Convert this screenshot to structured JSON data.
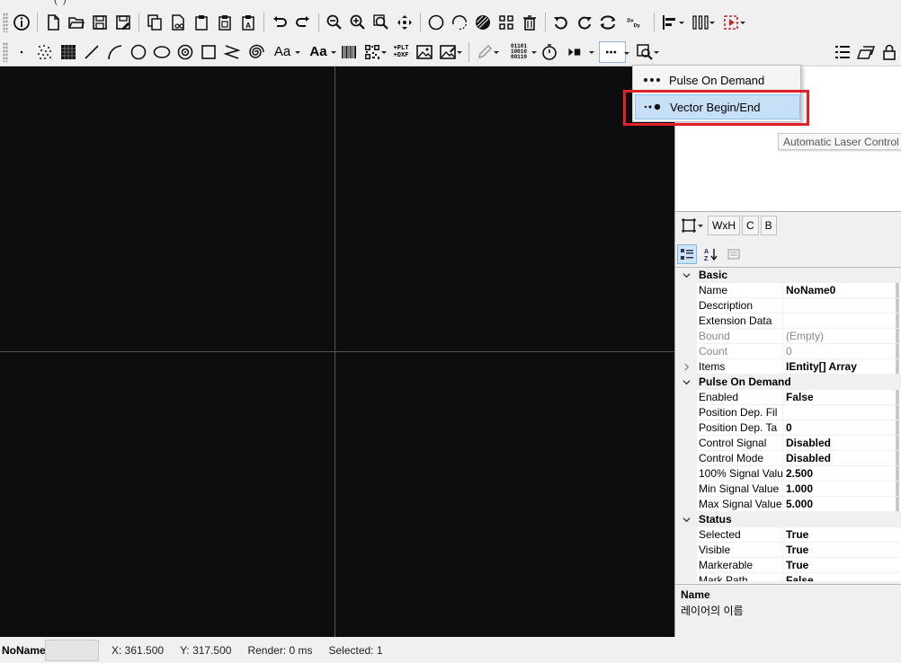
{
  "window": {
    "title_fragment": "(*)"
  },
  "toolbar_top": {
    "dx_dy_label": "DxDy"
  },
  "toolbar_bottom": {
    "font_label": "Aa",
    "font_bold_label": "Aa",
    "plt_dxf_label": "+PLT +DXF",
    "binary_label": "01101 10010 00110"
  },
  "dropdown_menu": {
    "items": [
      {
        "label": "Pulse On Demand",
        "highlighted": false
      },
      {
        "label": "Vector Begin/End",
        "highlighted": true
      }
    ]
  },
  "right_panel": {
    "tooltip": "Automatic Laser Control",
    "size_tabs": [
      "WxH",
      "C",
      "B"
    ]
  },
  "property_grid": {
    "categories": [
      {
        "name": "Basic",
        "props": [
          {
            "name": "Name",
            "value": "NoName0",
            "disabled": false
          },
          {
            "name": "Description",
            "value": "",
            "disabled": false
          },
          {
            "name": "Extension Data",
            "value": "",
            "disabled": false
          },
          {
            "name": "Bound",
            "value": "(Empty)",
            "disabled": true
          },
          {
            "name": "Count",
            "value": "0",
            "disabled": true
          },
          {
            "name": "Items",
            "value": "IEntity[] Array",
            "disabled": false,
            "expandable": true
          }
        ]
      },
      {
        "name": "Pulse On Demand",
        "props": [
          {
            "name": "Enabled",
            "value": "False"
          },
          {
            "name": "Position Dep. Fil",
            "value": ""
          },
          {
            "name": "Position Dep. Ta",
            "value": "0"
          },
          {
            "name": "Control Signal",
            "value": "Disabled"
          },
          {
            "name": "Control Mode",
            "value": "Disabled"
          },
          {
            "name": "100% Signal Valu",
            "value": "2.500"
          },
          {
            "name": "Min Signal Value",
            "value": "1.000"
          },
          {
            "name": "Max Signal Value",
            "value": "5.000"
          }
        ]
      },
      {
        "name": "Status",
        "props": [
          {
            "name": "Selected",
            "value": "True"
          },
          {
            "name": "Visible",
            "value": "True"
          },
          {
            "name": "Markerable",
            "value": "True"
          },
          {
            "name": "Mark Path",
            "value": "False"
          }
        ]
      }
    ]
  },
  "description_panel": {
    "title": "Name",
    "text": "레이어의 이름"
  },
  "status_bar": {
    "name": "NoName",
    "x": "X: 361.500",
    "y": "Y: 317.500",
    "render": "Render: 0 ms",
    "selected": "Selected: 1"
  },
  "colors": {
    "canvas_bg": "#0d0d0d",
    "menu_highlight": "#c6e0f7",
    "annotation_red": "#e0202a"
  }
}
